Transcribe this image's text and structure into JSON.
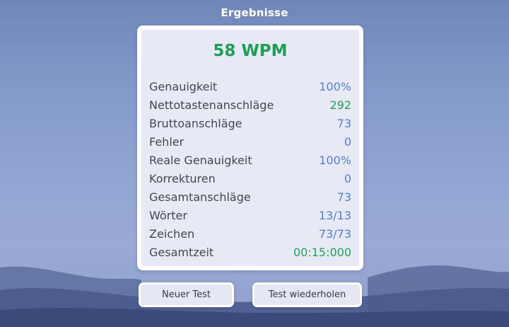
{
  "header": {
    "title": "Ergebnisse"
  },
  "results": {
    "wpm": "58 WPM",
    "stats": [
      {
        "label": "Genauigkeit",
        "value": "100%",
        "color": "#4f7ed6"
      },
      {
        "label": "Nettotastenanschläge",
        "value": "292",
        "color": "#1ea352"
      },
      {
        "label": "Bruttoanschläge",
        "value": "73",
        "color": "#4f7ed6"
      },
      {
        "label": "Fehler",
        "value": "0",
        "color": "#4f7ed6"
      },
      {
        "label": "Reale Genauigkeit",
        "value": "100%",
        "color": "#4f7ed6"
      },
      {
        "label": "Korrekturen",
        "value": "0",
        "color": "#4f7ed6"
      },
      {
        "label": "Gesamtanschläge",
        "value": "73",
        "color": "#4f7ed6"
      },
      {
        "label": "Wörter",
        "value": "13/13",
        "color": "#4f7ed6"
      },
      {
        "label": "Zeichen",
        "value": "73/73",
        "color": "#4f7ed6"
      },
      {
        "label": "Gesamtzeit",
        "value": "00:15:000",
        "color": "#1ea352"
      }
    ]
  },
  "actions": {
    "new_test_label": "Neuer Test",
    "repeat_test_label": "Test wiederholen"
  },
  "colors": {
    "wpm_green": "#1aa051",
    "value_blue": "#4f7ed6",
    "value_green": "#1ea352"
  }
}
